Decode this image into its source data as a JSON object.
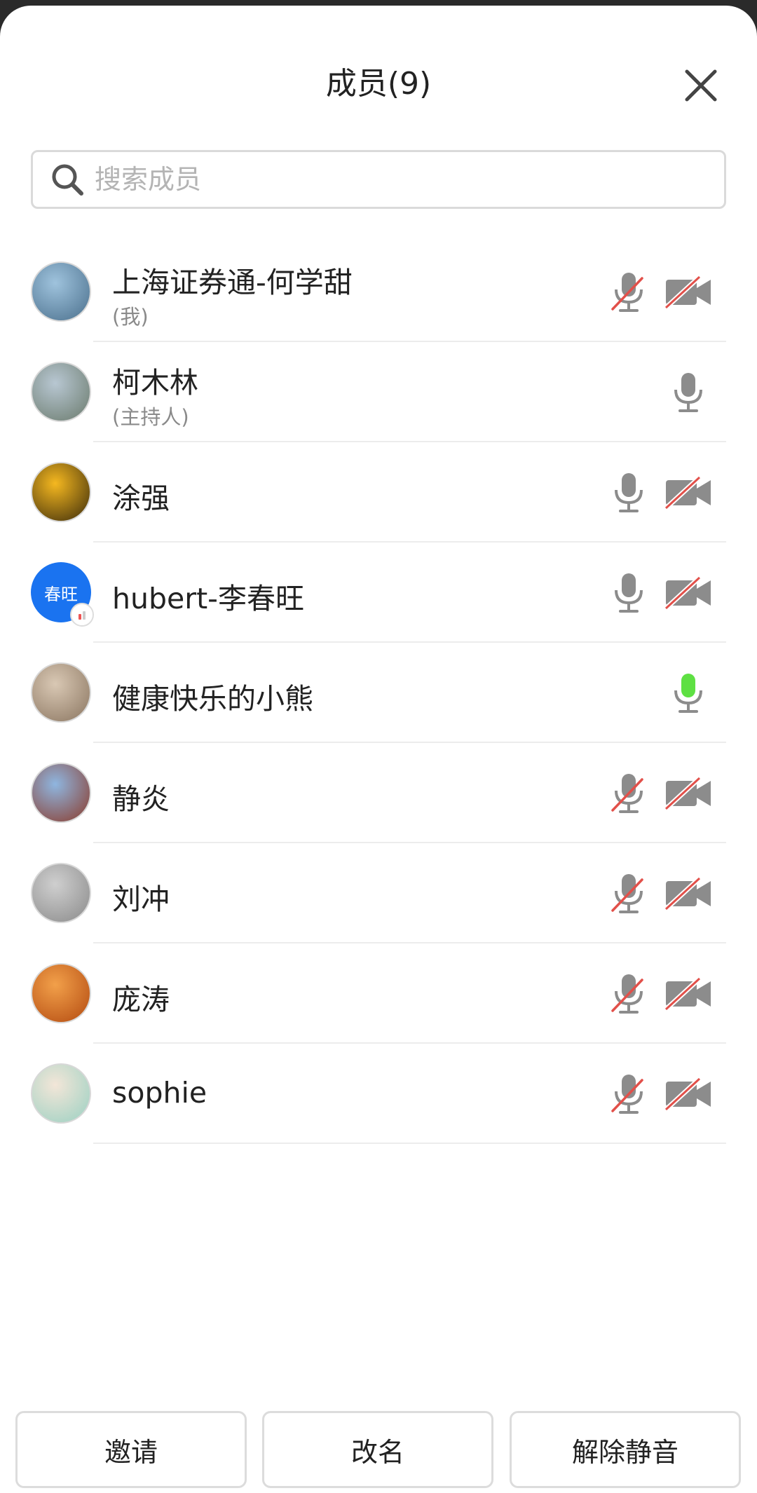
{
  "panel": {
    "title": "成员(9)"
  },
  "search": {
    "placeholder": "搜索成员"
  },
  "members": [
    {
      "name": "上海证券通-何学甜",
      "role": "(我)",
      "mic": "muted",
      "camera": "off",
      "avatar_colors": [
        "#9fc3dd",
        "#4a6f8c"
      ]
    },
    {
      "name": "柯木林",
      "role": "(主持人)",
      "mic": "on",
      "camera": "none",
      "avatar_colors": [
        "#b8c7d2",
        "#6a7a6c"
      ]
    },
    {
      "name": "涂强",
      "role": "",
      "mic": "on",
      "camera": "off",
      "avatar_colors": [
        "#f5b820",
        "#3a2a0a"
      ]
    },
    {
      "name": "hubert-李春旺",
      "role": "",
      "mic": "on",
      "camera": "off",
      "avatar_text": "春旺",
      "avatar_colors": [
        "#1a73f0",
        "#1a73f0"
      ]
    },
    {
      "name": "健康快乐的小熊",
      "role": "",
      "mic": "speaking",
      "camera": "none",
      "avatar_colors": [
        "#d9c8b4",
        "#8a7560"
      ]
    },
    {
      "name": "静炎",
      "role": "",
      "mic": "muted",
      "camera": "off",
      "avatar_colors": [
        "#8fb6e0",
        "#8a3a2a"
      ]
    },
    {
      "name": "刘冲",
      "role": "",
      "mic": "muted",
      "camera": "off",
      "avatar_colors": [
        "#cfcfcf",
        "#8a8a8a"
      ]
    },
    {
      "name": "庞涛",
      "role": "",
      "mic": "muted",
      "camera": "off",
      "avatar_colors": [
        "#f2a04a",
        "#b34a10"
      ]
    },
    {
      "name": "sophie",
      "role": "",
      "mic": "muted",
      "camera": "off",
      "avatar_colors": [
        "#f3e6d8",
        "#9ad0c2"
      ]
    }
  ],
  "buttons": {
    "invite": "邀请",
    "rename": "改名",
    "unmute": "解除静音"
  },
  "colors": {
    "icon_gray": "#8c8c8c",
    "mute_slash": "#e2504a",
    "speaking_green": "#5ee043",
    "avatar_text_bg": "#1a73f0"
  }
}
